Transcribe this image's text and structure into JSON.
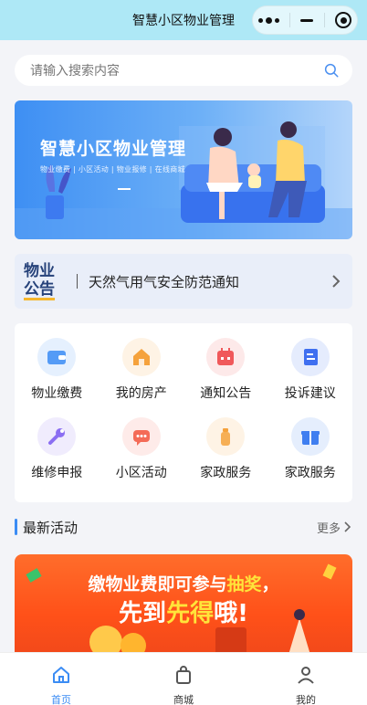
{
  "header": {
    "title": "智慧小区物业管理"
  },
  "search": {
    "placeholder": "请输入搜索内容"
  },
  "banner": {
    "title": "智慧小区物业管理",
    "subtitle": "物业缴费 | 小区活动 | 物业报修 | 在线商城"
  },
  "notice": {
    "badge_top": "物业",
    "badge_bottom": "公告",
    "text": "天然气用气安全防范通知"
  },
  "grid": {
    "items": [
      {
        "label": "物业缴费",
        "icon": "wallet-icon",
        "color": "#3b8cf4"
      },
      {
        "label": "我的房产",
        "icon": "house-icon",
        "color": "#f5a23c"
      },
      {
        "label": "通知公告",
        "icon": "calendar-icon",
        "color": "#f0585a"
      },
      {
        "label": "投诉建议",
        "icon": "document-icon",
        "color": "#3f6ff0"
      },
      {
        "label": "维修申报",
        "icon": "wrench-icon",
        "color": "#8b6ef2"
      },
      {
        "label": "小区活动",
        "icon": "chat-icon",
        "color": "#f46b57"
      },
      {
        "label": "家政服务",
        "icon": "bottle-icon",
        "color": "#f5a23c"
      },
      {
        "label": "家政服务",
        "icon": "gift-icon",
        "color": "#3f7ef0"
      }
    ]
  },
  "section": {
    "title": "最新活动",
    "more": "更多"
  },
  "promo": {
    "line1": "缴物业费即可参与",
    "line1_highlight": "抽奖",
    "line1_end": "，",
    "line2": "先到",
    "line2_highlight": "先得",
    "line2_end": "哦!"
  },
  "tabbar": {
    "items": [
      {
        "label": "首页",
        "icon": "home-icon",
        "active": true
      },
      {
        "label": "商城",
        "icon": "shopping-bag-icon",
        "active": false
      },
      {
        "label": "我的",
        "icon": "user-icon",
        "active": false
      }
    ]
  },
  "colors": {
    "accent": "#3b8cf4",
    "header_bg": "#aee8f6",
    "promo_highlight": "#ffe43a"
  }
}
